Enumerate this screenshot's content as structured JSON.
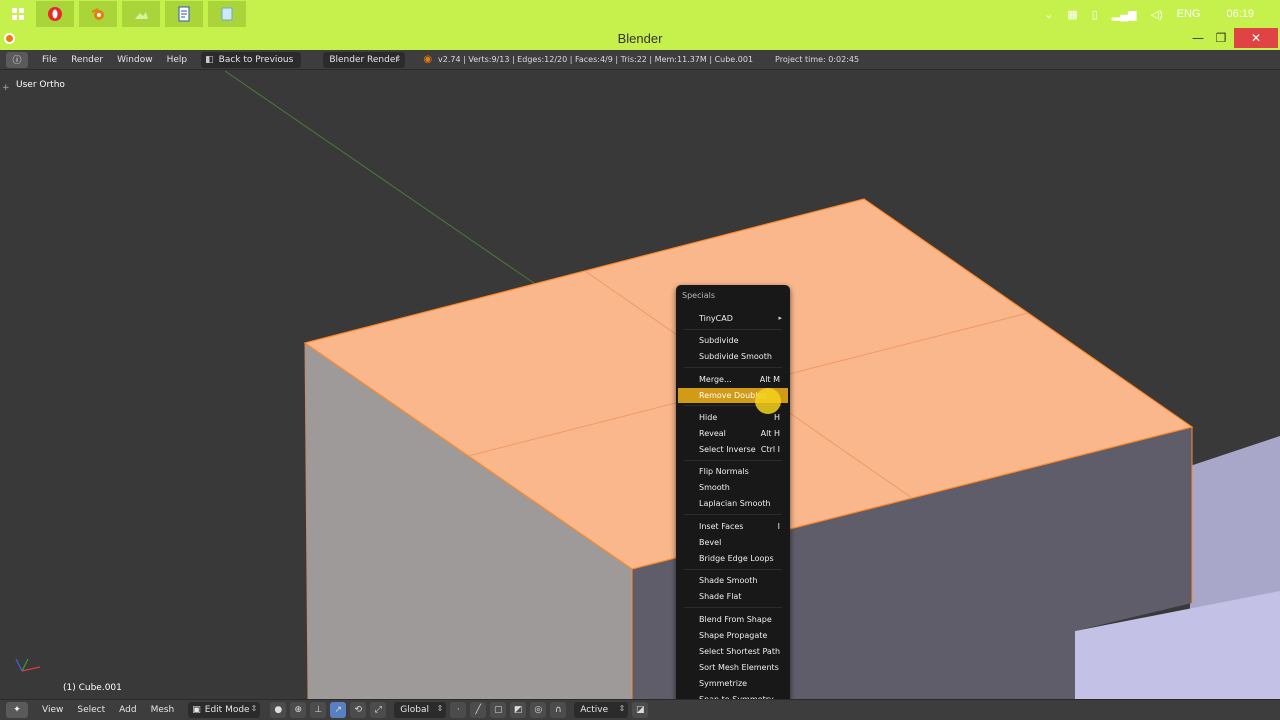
{
  "taskbar": {
    "language": "ENG",
    "clock": "06:19"
  },
  "window": {
    "title": "Blender",
    "minimize": "—",
    "maximize": "❐",
    "close": "✕"
  },
  "info_header": {
    "menus": [
      "File",
      "Render",
      "Window",
      "Help"
    ],
    "back_button": "Back to Previous",
    "render_engine": "Blender Render",
    "stats": "v2.74 | Verts:9/13 | Edges:12/20 | Faces:4/9 | Tris:22 | Mem:11.37M | Cube.001",
    "project_time": "Project time: 0:02:45"
  },
  "viewport": {
    "view_label": "User Ortho",
    "object_label": "(1) Cube.001"
  },
  "specials_menu": {
    "title": "Specials",
    "items": [
      {
        "label": "TinyCAD",
        "shortcut": "",
        "submenu": true
      },
      {
        "label": "Subdivide",
        "shortcut": ""
      },
      {
        "label": "Subdivide Smooth",
        "shortcut": ""
      },
      {
        "label": "Merge...",
        "shortcut": "Alt M"
      },
      {
        "label": "Remove Doubles",
        "shortcut": "",
        "active": true
      },
      {
        "label": "Hide",
        "shortcut": "H"
      },
      {
        "label": "Reveal",
        "shortcut": "Alt H"
      },
      {
        "label": "Select Inverse",
        "shortcut": "Ctrl I"
      },
      {
        "label": "Flip Normals",
        "shortcut": ""
      },
      {
        "label": "Smooth",
        "shortcut": ""
      },
      {
        "label": "Laplacian Smooth",
        "shortcut": ""
      },
      {
        "label": "Inset Faces",
        "shortcut": "I"
      },
      {
        "label": "Bevel",
        "shortcut": ""
      },
      {
        "label": "Bridge Edge Loops",
        "shortcut": ""
      },
      {
        "label": "Shade Smooth",
        "shortcut": ""
      },
      {
        "label": "Shade Flat",
        "shortcut": ""
      },
      {
        "label": "Blend From Shape",
        "shortcut": ""
      },
      {
        "label": "Shape Propagate",
        "shortcut": ""
      },
      {
        "label": "Select Shortest Path",
        "shortcut": ""
      },
      {
        "label": "Sort Mesh Elements",
        "shortcut": ""
      },
      {
        "label": "Symmetrize",
        "shortcut": ""
      },
      {
        "label": "Snap to Symmetry",
        "shortcut": ""
      }
    ]
  },
  "view3d_header": {
    "menus": [
      "View",
      "Select",
      "Add",
      "Mesh"
    ],
    "mode": "Edit Mode",
    "orientation": "Global",
    "pivot": "Active"
  },
  "colors": {
    "accent": "#c6f04b",
    "selected_face": "#f9b78b",
    "menu_highlight": "#d19a17",
    "cursor_highlight": "#f4d21c"
  }
}
